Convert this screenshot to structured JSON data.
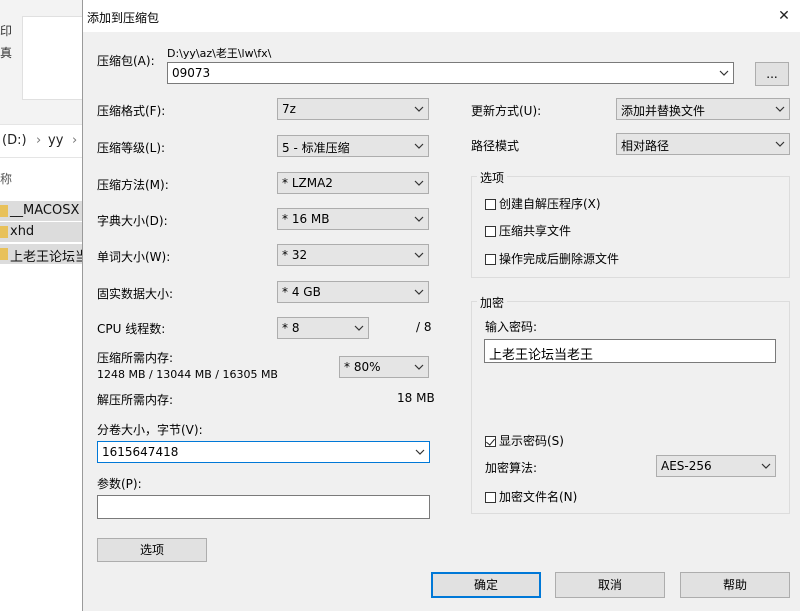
{
  "background": {
    "ribbon_chars": [
      "印",
      "真"
    ],
    "address_parts": [
      "(D:)",
      "yy"
    ],
    "column_header": "称",
    "files": [
      {
        "name": "__MACOSX",
        "selected": true
      },
      {
        "name": "xhd",
        "selected": true
      },
      {
        "name": "上老王论坛当",
        "selected": true
      }
    ]
  },
  "dialog": {
    "title": "添加到压缩包",
    "archive": {
      "label": "压缩包(A):",
      "path": "D:\\yy\\az\\老王\\lw\\fx\\",
      "name": "09073",
      "browse_label": "..."
    },
    "format": {
      "label": "压缩格式(F):",
      "value": "7z"
    },
    "level": {
      "label": "压缩等级(L):",
      "value": "5 - 标准压缩"
    },
    "method": {
      "label": "压缩方法(M):",
      "value": "* LZMA2"
    },
    "dict": {
      "label": "字典大小(D):",
      "value": "* 16 MB"
    },
    "word": {
      "label": "单词大小(W):",
      "value": "* 32"
    },
    "solid": {
      "label": "固实数据大小:",
      "value": "* 4 GB"
    },
    "threads": {
      "label": "CPU 线程数:",
      "value": "* 8",
      "max": "/ 8"
    },
    "mem_compress": {
      "label": "压缩所需内存:",
      "detail": "1248 MB / 13044 MB / 16305 MB",
      "value": "* 80%"
    },
    "mem_decompress": {
      "label": "解压所需内存:",
      "value": "18 MB"
    },
    "volume": {
      "label": "分卷大小，字节(V):",
      "value": "1615647418"
    },
    "params": {
      "label": "参数(P):",
      "value": ""
    },
    "options_button": "选项",
    "update": {
      "label": "更新方式(U):",
      "value": "添加并替换文件"
    },
    "pathmode": {
      "label": "路径模式",
      "value": "相对路径"
    },
    "options_group": {
      "title": "选项",
      "sfx": {
        "label": "创建自解压程序(X)",
        "checked": false
      },
      "shared": {
        "label": "压缩共享文件",
        "checked": false
      },
      "delete": {
        "label": "操作完成后删除源文件",
        "checked": false
      }
    },
    "encryption": {
      "title": "加密",
      "password_label": "输入密码:",
      "password_value": "上老王论坛当老王",
      "show_password": {
        "label": "显示密码(S)",
        "checked": true
      },
      "method_label": "加密算法:",
      "method_value": "AES-256",
      "encrypt_names": {
        "label": "加密文件名(N)",
        "checked": false
      }
    },
    "ok": "确定",
    "cancel": "取消",
    "help": "帮助"
  }
}
